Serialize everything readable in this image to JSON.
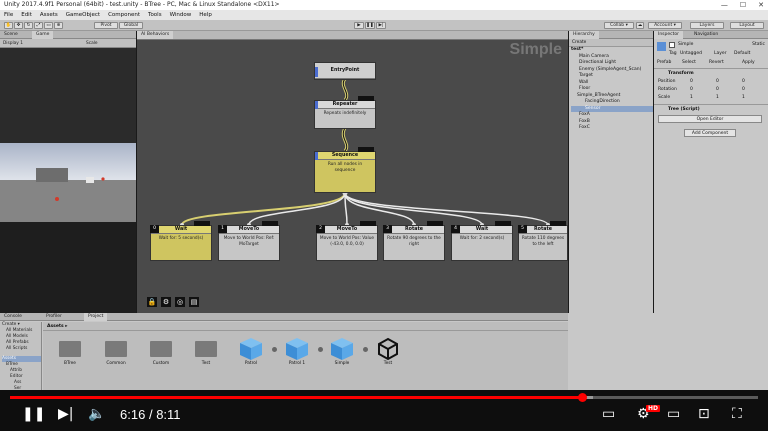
{
  "window": {
    "title": "Unity 2017.4.9f1 Personal (64bit) - test.unity - BTree - PC, Mac & Linux Standalone <DX11>",
    "controls": [
      "—",
      "☐",
      "✕"
    ]
  },
  "menu": [
    "File",
    "Edit",
    "Assets",
    "GameObject",
    "Component",
    "Tools",
    "Window",
    "Help"
  ],
  "toolbar": {
    "pivot": "Pivot",
    "global": "Global",
    "collab": "Collab ▾",
    "account": "Account ▾",
    "layers": "Layers",
    "layout": "Layout"
  },
  "scene_panel": {
    "tabs": [
      "Scene",
      "Game"
    ],
    "shaded": "Shaded",
    "display": "Display 1",
    "scale": "Scale"
  },
  "graph": {
    "tab": "AI Behaviors",
    "overlay_title": "Simple",
    "nodes": [
      {
        "id": "entry",
        "title": "EntryPoint",
        "body": ""
      },
      {
        "id": "repeater",
        "title": "Repeater",
        "body": "Repeats indefinitely"
      },
      {
        "id": "sequence",
        "title": "Sequence",
        "body": "Run all nodes in sequence"
      },
      {
        "id": "wait1",
        "index": "0",
        "title": "Wait",
        "body": "Wait for: 5 second(s)"
      },
      {
        "id": "moveto1",
        "index": "1",
        "title": "MoveTo",
        "body": "Move to World Pos: Ref: MoTarget"
      },
      {
        "id": "moveto2",
        "index": "2",
        "title": "MoveTo",
        "body": "Move to World Pos: Value (-43.0, 0.0, 0.0)"
      },
      {
        "id": "rotate1",
        "index": "3",
        "title": "Rotate",
        "body": "Rotate 90 degrees to the right"
      },
      {
        "id": "wait2",
        "index": "4",
        "title": "Wait",
        "body": "Wait for: 2 second(s)"
      },
      {
        "id": "rotate2",
        "index": "5",
        "title": "Rotate",
        "body": "Rotate 110 degrees to the left"
      }
    ]
  },
  "hierarchy": {
    "tab": "Hierarchy",
    "create": "Create",
    "scene": "test*",
    "items": [
      "Main Camera",
      "Directional Light",
      "Enemy (SimpleAgent_Scan)",
      "Target",
      "Wall",
      "Floor",
      "Simple_BTreeAgent",
      "FacingDirection",
      "Sensor",
      "FoxA",
      "FoxB",
      "FoxC"
    ]
  },
  "inspector": {
    "tabs": [
      "Inspector",
      "Navigation"
    ],
    "object_name": "Simple",
    "static": "Static",
    "tag_label": "Tag",
    "tag": "Untagged",
    "layer_label": "Layer",
    "layer": "Default",
    "prefab": [
      "Prefab",
      "Select",
      "Revert",
      "Apply"
    ],
    "transform_title": "Transform",
    "rows": [
      {
        "label": "Position",
        "x": "0",
        "y": "0",
        "z": "0"
      },
      {
        "label": "Rotation",
        "x": "0",
        "y": "0",
        "z": "0"
      },
      {
        "label": "Scale",
        "x": "1",
        "y": "1",
        "z": "1"
      }
    ],
    "script_title": "Tree (Script)",
    "open_editor": "Open Editor",
    "add_component": "Add Component"
  },
  "project": {
    "tabs": [
      "Console",
      "Profiler",
      "Project"
    ],
    "create": "Create ▾",
    "favorites": [
      "All Materials",
      "All Models",
      "All Prefabs",
      "All Scripts"
    ],
    "assets_label": "Assets",
    "tree": [
      "Assets",
      "BTree",
      "Attrib",
      "Editor",
      "Ass",
      "Ser"
    ],
    "breadcrumb": "Assets ▸",
    "items": [
      {
        "label": "BTree",
        "kind": "folder"
      },
      {
        "label": "Common",
        "kind": "folder"
      },
      {
        "label": "Custom",
        "kind": "folder"
      },
      {
        "label": "Test",
        "kind": "folder"
      },
      {
        "label": "Patrol",
        "kind": "cube"
      },
      {
        "label": "Patrol 1",
        "kind": "cube"
      },
      {
        "label": "Simple",
        "kind": "cube"
      },
      {
        "label": "Test",
        "kind": "unity"
      }
    ]
  },
  "player": {
    "current": "6:16",
    "duration": "8:11",
    "separator": "/",
    "progress_fraction": 0.766,
    "buffered_fraction": 0.78,
    "hd_badge": "HD"
  }
}
